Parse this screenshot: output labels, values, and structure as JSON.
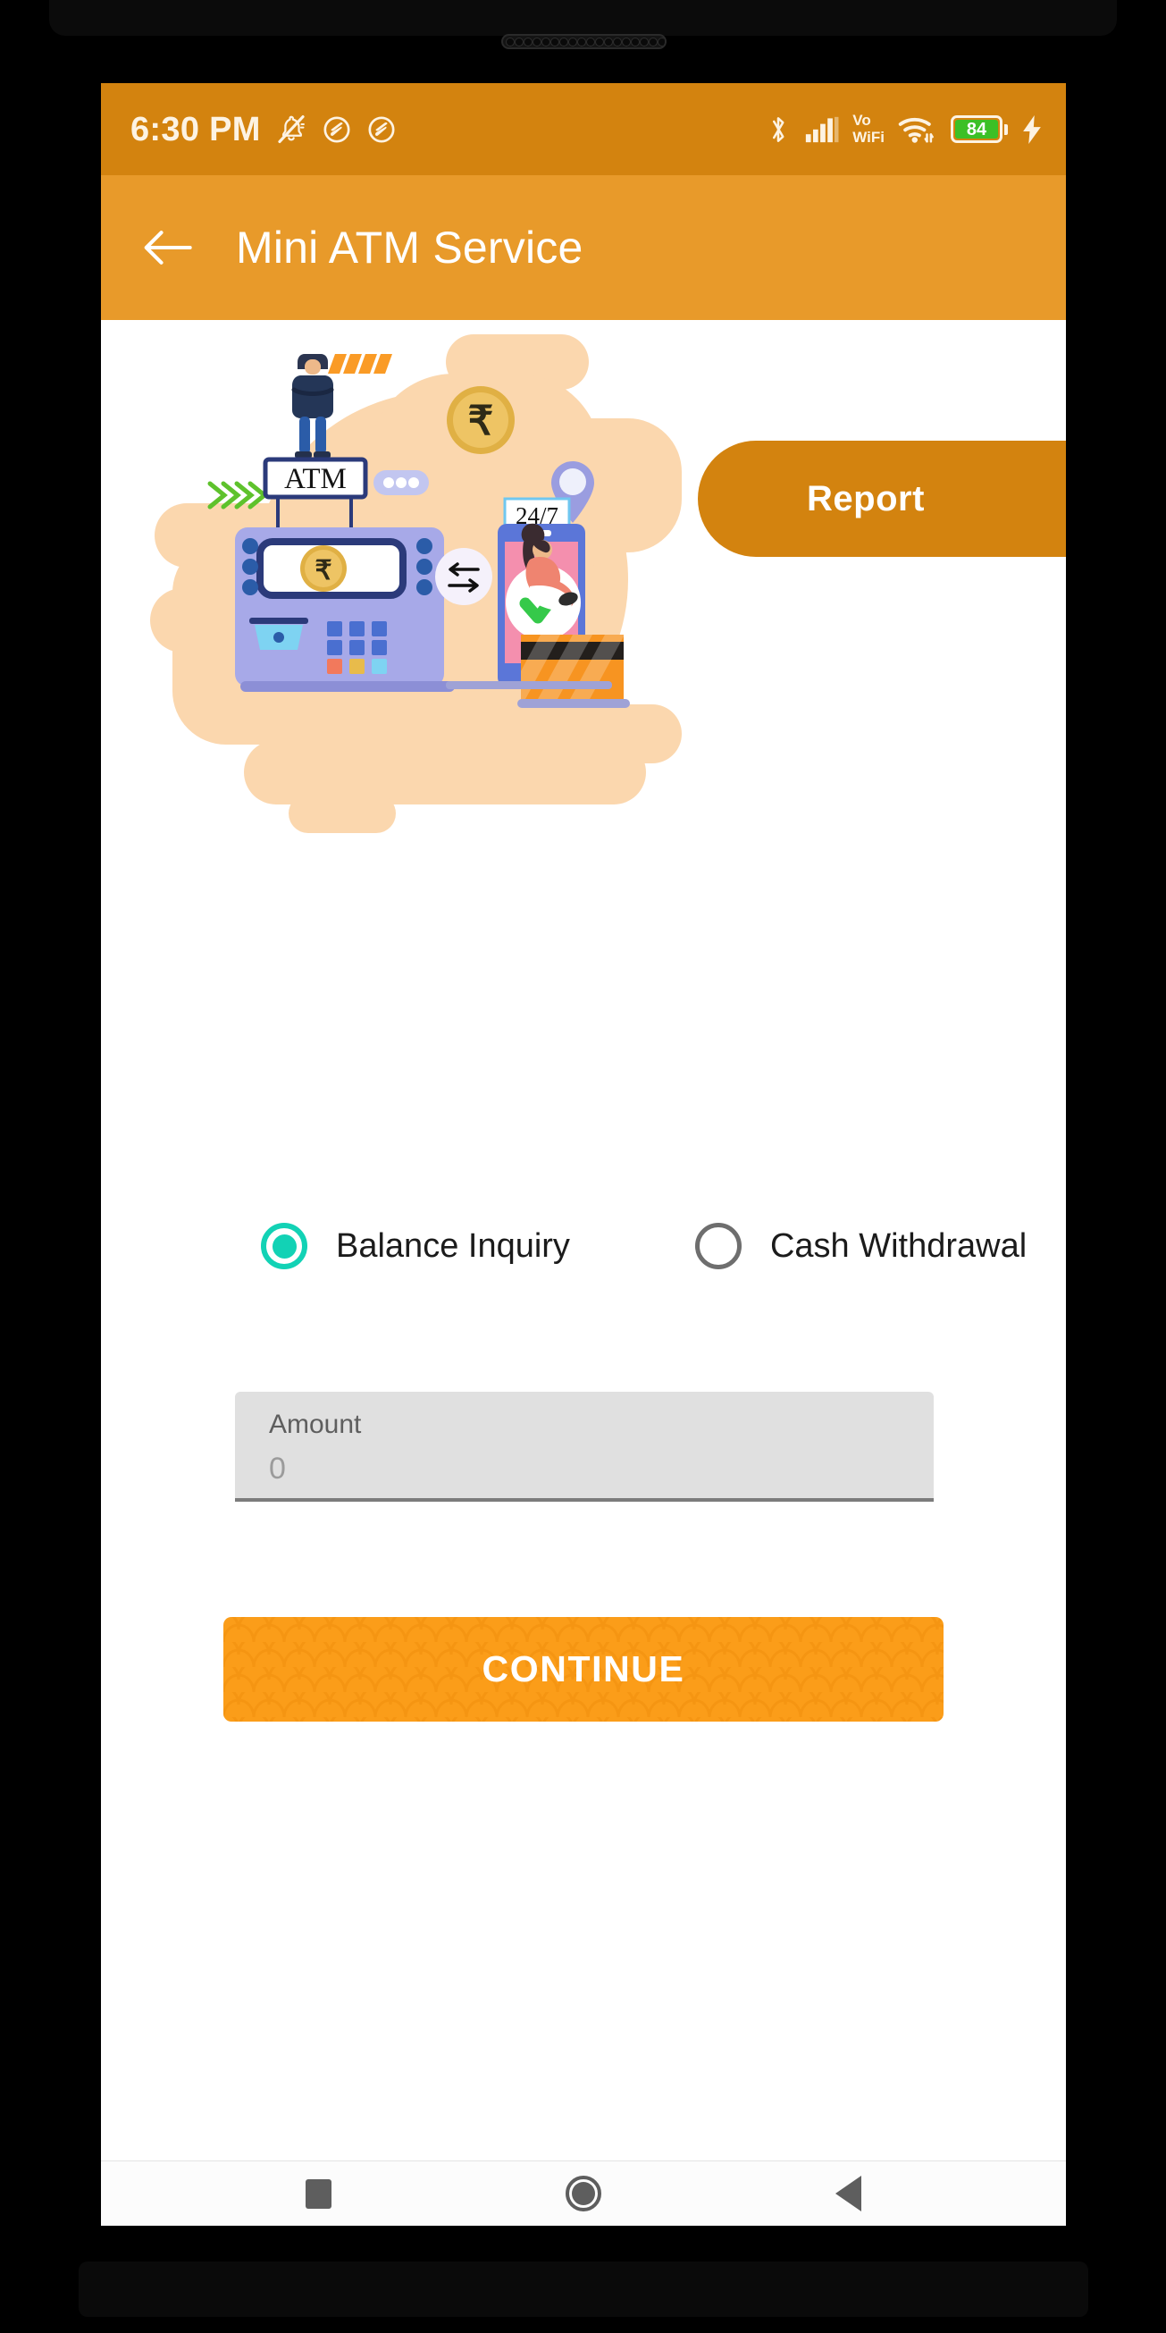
{
  "status_bar": {
    "clock": "6:30 PM",
    "icons_left": [
      "bell-muted-icon",
      "do-not-disturb-icon",
      "do-not-disturb-icon"
    ],
    "bluetooth_icon": "bluetooth-icon",
    "signal_icon": "cellular-signal-icon",
    "volte_line1": "Vo",
    "volte_line2": "WiFi",
    "wifi_icon": "wifi-icon",
    "battery_level": "84",
    "charging_icon": "charging-bolt-icon",
    "background_color": "#d3830f"
  },
  "app_bar": {
    "back_icon": "back-arrow-icon",
    "title": "Mini ATM Service",
    "background_color": "#e89a2a"
  },
  "content": {
    "report_button": {
      "label": "Report",
      "background_color": "#d3830f"
    },
    "illustration": {
      "name": "mini-atm-service-illustration",
      "atm_sign_text": "ATM",
      "phone_badge_text": "24/7",
      "currency_symbol": "₹",
      "blob_color": "#fbd7ae",
      "atm_body_color": "#a7a9e8",
      "card_color": "#f79421"
    },
    "options": [
      {
        "label": "Balance Inquiry",
        "selected": true,
        "accent_color": "#12d2b5"
      },
      {
        "label": "Cash Withdrawal",
        "selected": false,
        "accent_color": "#6e6e6e"
      }
    ],
    "amount_field": {
      "label": "Amount",
      "value": "",
      "placeholder": "0",
      "background_color": "#e0e0e0"
    },
    "continue_button": {
      "label": "CONTINUE",
      "background_color": "#fb9d19"
    }
  },
  "nav_bar": {
    "recents": "recents-square",
    "home": "home-circle",
    "back": "back-triangle"
  }
}
